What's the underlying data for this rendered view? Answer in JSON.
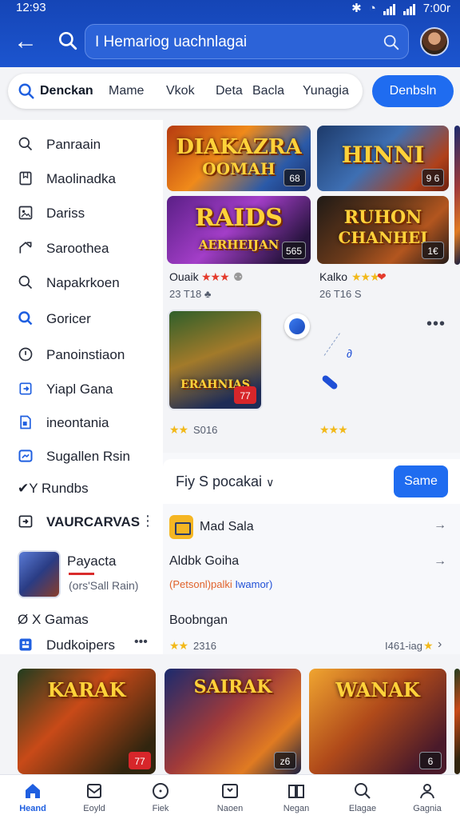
{
  "status_bar": {
    "time": "12:93",
    "battery": "7:00r"
  },
  "app_bar": {
    "search_query": "I Hemariog uachnlagai"
  },
  "filter_bar": {
    "chips": [
      "Denckan",
      "Mame",
      "Vkok",
      "Deta",
      "Bacla",
      "Yunagia"
    ],
    "primary_button": "Denbsln"
  },
  "sidebar": {
    "items": [
      {
        "label": "Panraain",
        "icon": "search-icon"
      },
      {
        "label": "Maolinadka",
        "icon": "bookmark-icon"
      },
      {
        "label": "Dariss",
        "icon": "image-icon"
      },
      {
        "label": "Saroothea",
        "icon": "share-icon"
      },
      {
        "label": "Napakrkoen",
        "icon": "search-icon"
      },
      {
        "label": "Goricer",
        "icon": "search-icon"
      },
      {
        "label": "Panoinstiaon",
        "icon": "clock-icon"
      },
      {
        "label": "Yiapl Gana",
        "icon": "login-icon"
      },
      {
        "label": "ineontania",
        "icon": "document-icon"
      },
      {
        "label": "Sugallen Rsin",
        "icon": "tablet-icon"
      }
    ],
    "section_rundbs": "✔Y Rundbs",
    "section_vaurcarvas": "VAURCARVAS",
    "featured": {
      "title": "Payacta",
      "subtitle": "(ors'Sall Rain)"
    },
    "section_games": "Ø X Gamas",
    "developers": "Dudkoipers",
    "developers_more": "•••"
  },
  "top_cards": [
    {
      "title_line1": "DIAKAZRA",
      "title_line2": "OOMAH",
      "badge": "68"
    },
    {
      "title_line1": "HINNI",
      "title_line2": "",
      "badge": "9 6"
    },
    {
      "title_line1": "RAIDS",
      "title_line2": "AERHEIJAN",
      "badge": "565"
    },
    {
      "title_line1": "RUHON",
      "title_line2": "CHANHEI",
      "badge": "1€"
    }
  ],
  "card_meta": [
    {
      "name": "Ouaik",
      "stars": "★★★",
      "extra": "⚉",
      "sub": "23 T18 ♣"
    },
    {
      "name": "Kalko",
      "stars": "★★★",
      "extra": "❤",
      "sub": "26 T16 S"
    }
  ],
  "mid_cards": [
    {
      "title": "ERAHNIAS",
      "badge": "77",
      "stars": "★★",
      "count": "S016"
    },
    {
      "stars": "★★★",
      "dots": "•••"
    }
  ],
  "sort_bar": {
    "label": "Fiy S pocakai",
    "button": "Same"
  },
  "list_rows": [
    {
      "label": "Mad Sala"
    },
    {
      "label": "Aldbk Goiha",
      "sub_orange": "(Petsonl)palki",
      "sub_blue": "Iwamor)"
    },
    {
      "label": "Boobngan",
      "stars": "★★",
      "count": "2316",
      "right": "I461-iag"
    }
  ],
  "bottom_cards": [
    {
      "title": "KARAK",
      "badge": "77"
    },
    {
      "title": "SAIRAK",
      "badge": "z6"
    },
    {
      "title": "WANAK",
      "badge": "6"
    }
  ],
  "bottom_nav": [
    "Heand",
    "Eoyld",
    "Fiek",
    "Naoen",
    "Negan",
    "Elagae",
    "Gagnia"
  ],
  "colors": {
    "app_bar": "#1c55cf",
    "primary": "#1f6cf0",
    "accent_red": "#e43a2c",
    "star_gold": "#f2b91a"
  }
}
